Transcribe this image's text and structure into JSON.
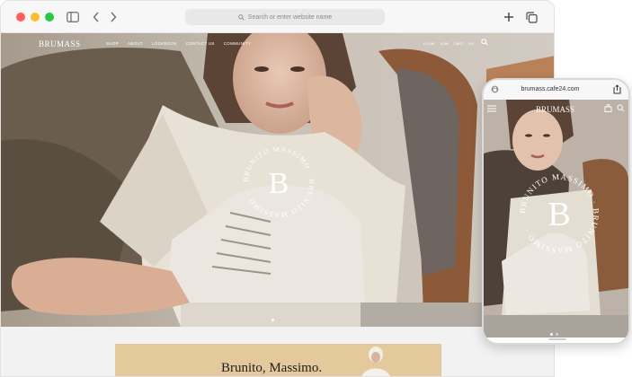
{
  "browser": {
    "address_placeholder": "Search or enter website name",
    "icons": [
      "sidebar-icon",
      "back-icon",
      "forward-icon",
      "search-icon",
      "new-tab-icon",
      "tabs-icon"
    ]
  },
  "site": {
    "logo": "BRUMASS",
    "menu": [
      "SHOP",
      "ABOUT",
      "LOOKBOOK",
      "CONTACT US",
      "COMMUNITY"
    ],
    "util": [
      "LOGIN",
      "JOIN",
      "CART",
      "MY"
    ],
    "emblem_text": "BRUNITO MASSIMO · BRUNITO MASSIMO ·",
    "emblem_letter": "B"
  },
  "banner": {
    "title": "Brunito, Massimo."
  },
  "phone": {
    "url": "brumass.cafe24.com",
    "logo": "BRUMASS",
    "emblem_text": "BRUNITO MASSIMO · BRUNITO MASSIMO ·",
    "emblem_letter": "B"
  },
  "colors": {
    "accent": "#e3c99c",
    "hero": "#bfb6ab"
  }
}
